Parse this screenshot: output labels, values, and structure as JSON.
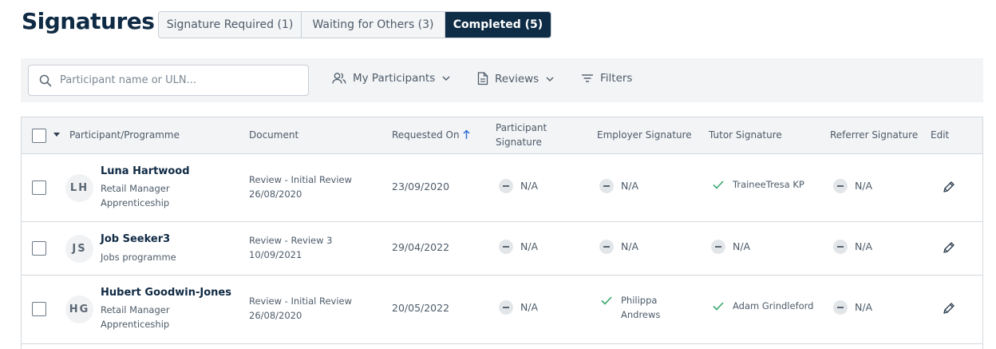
{
  "page": {
    "title": "Signatures"
  },
  "tabs": [
    {
      "label": "Signature Required (1)",
      "active": false
    },
    {
      "label": "Waiting for Others (3)",
      "active": false
    },
    {
      "label": "Completed (5)",
      "active": true
    }
  ],
  "toolbar": {
    "search_placeholder": "Participant name or ULN...",
    "participants_label": "My Participants",
    "reviews_label": "Reviews",
    "filters_label": "Filters"
  },
  "table": {
    "headers": {
      "participant": "Participant/Programme",
      "document": "Document",
      "requested_on": "Requested On",
      "participant_sig_1": "Participant",
      "participant_sig_2": "Signature",
      "employer_sig": "Employer Signature",
      "tutor_sig": "Tutor Signature",
      "referrer_sig": "Referrer Signature",
      "edit": "Edit"
    },
    "rows": [
      {
        "initials": "LH",
        "name": "Luna Hartwood",
        "programme_1": "Retail Manager",
        "programme_2": "Apprenticeship",
        "document_1": "Review - Initial Review",
        "document_2": "26/08/2020",
        "requested_on": "23/09/2020",
        "participant_sig": "N/A",
        "employer_sig": "N/A",
        "tutor_sig": "TraineeTresa KP",
        "referrer_sig": "N/A"
      },
      {
        "initials": "JS",
        "name": "Job Seeker3",
        "programme_1": "Jobs programme",
        "programme_2": "",
        "document_1": "Review - Review 3",
        "document_2": "10/09/2021",
        "requested_on": "29/04/2022",
        "participant_sig": "N/A",
        "employer_sig": "N/A",
        "tutor_sig": "N/A",
        "referrer_sig": "N/A"
      },
      {
        "initials": "HG",
        "name": "Hubert Goodwin-Jones",
        "programme_1": "Retail Manager",
        "programme_2": "Apprenticeship",
        "document_1": "Review - Initial Review",
        "document_2": "26/08/2020",
        "requested_on": "20/05/2022",
        "participant_sig": "N/A",
        "employer_sig_1": "Philippa",
        "employer_sig_2": "Andrews",
        "tutor_sig": "Adam Grindleford",
        "referrer_sig": "N/A"
      }
    ]
  },
  "colors": {
    "active_tab": "#0e2c45",
    "check_green": "#3aa76d",
    "sort_arrow": "#2f6fd6"
  },
  "icons": {
    "search": "search-icon",
    "participants": "people-icon",
    "reviews": "document-icon",
    "filters": "filter-icon",
    "sort": "arrow-up-icon",
    "edit": "pencil-icon",
    "signed": "check-icon",
    "not_applicable": "dash-icon"
  }
}
